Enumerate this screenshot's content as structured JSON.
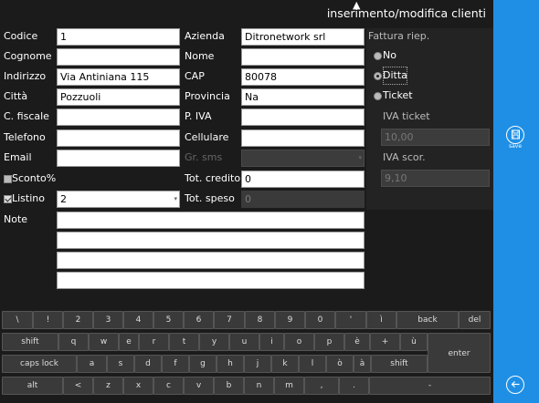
{
  "window": {
    "title": "inserimento/modifica clienti"
  },
  "form": {
    "codice": {
      "label": "Codice",
      "value": "1"
    },
    "azienda": {
      "label": "Azienda",
      "value": "Ditronetwork srl"
    },
    "cognome": {
      "label": "Cognome",
      "value": ""
    },
    "nome": {
      "label": "Nome",
      "value": ""
    },
    "indirizzo": {
      "label": "Indirizzo",
      "value": "Via Antiniana 115"
    },
    "cap": {
      "label": "CAP",
      "value": "80078"
    },
    "citta": {
      "label": "Città",
      "value": "Pozzuoli"
    },
    "provincia": {
      "label": "Provincia",
      "value": "Na"
    },
    "cfiscale": {
      "label": "C. fiscale",
      "value": ""
    },
    "piva": {
      "label": "P. IVA",
      "value": ""
    },
    "telefono": {
      "label": "Telefono",
      "value": ""
    },
    "cellulare": {
      "label": "Cellulare",
      "value": ""
    },
    "email": {
      "label": "Email",
      "value": ""
    },
    "grsms": {
      "label": "Gr. sms",
      "value": ""
    },
    "sconto": {
      "label": "Sconto%",
      "checked": false
    },
    "totcredito": {
      "label": "Tot. credito",
      "value": "0"
    },
    "listino": {
      "label": "Listino",
      "checked": true,
      "value": "2"
    },
    "totspeso": {
      "label": "Tot. speso",
      "value": "0"
    },
    "note": {
      "label": "Note",
      "lines": [
        "",
        "",
        "",
        ""
      ]
    }
  },
  "fattura": {
    "label": "Fattura riep.",
    "options": [
      {
        "label": "No",
        "selected": false
      },
      {
        "label": "Ditta",
        "selected": true
      },
      {
        "label": "Ticket",
        "selected": false
      }
    ],
    "iva_ticket": {
      "label": "IVA ticket",
      "value": "10,00"
    },
    "iva_scor": {
      "label": "IVA scor.",
      "value": "9,10"
    }
  },
  "charm": {
    "save_label": "save"
  },
  "keyboard": {
    "row1": [
      "\\",
      "!",
      "2",
      "3",
      "4",
      "5",
      "6",
      "7",
      "8",
      "9",
      "0",
      "'",
      "ì",
      "back",
      "del"
    ],
    "row2": [
      "shift",
      "q",
      "w",
      "e",
      "r",
      "t",
      "y",
      "u",
      "i",
      "o",
      "p",
      "è",
      "+",
      "ù",
      "enter"
    ],
    "row3": [
      "caps lock",
      "a",
      "s",
      "d",
      "f",
      "g",
      "h",
      "j",
      "k",
      "l",
      "ò",
      "à",
      "shift"
    ],
    "row4": [
      "alt",
      "<",
      "z",
      "x",
      "c",
      "v",
      "b",
      "n",
      "m",
      ",",
      ".",
      "-"
    ]
  }
}
